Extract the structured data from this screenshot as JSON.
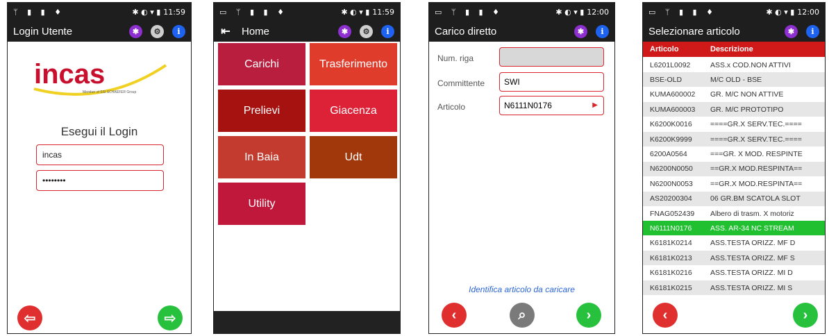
{
  "screens": {
    "login": {
      "status_time": "11:59",
      "title": "Login Utente",
      "logo_text": "incas",
      "logo_subtext": "Member of SSI SCHAEFER Group",
      "heading": "Esegui il Login",
      "username": "incas",
      "password": "••••••••"
    },
    "home": {
      "status_time": "11:59",
      "title": "Home",
      "tiles": [
        "Carichi",
        "Trasferimento",
        "Prelievi",
        "Giacenza",
        "In Baia",
        "Udt",
        "Utility"
      ],
      "tile_colors": [
        "#b91e3f",
        "#e03c2c",
        "#a5120f",
        "#dd2238",
        "#c23b2e",
        "#a0380c",
        "#bf183a"
      ]
    },
    "carico": {
      "status_time": "12:00",
      "title": "Carico diretto",
      "fields": [
        {
          "label": "Num. riga",
          "value": ""
        },
        {
          "label": "Committente",
          "value": "SWI"
        },
        {
          "label": "Articolo",
          "value": "N6111N0176"
        }
      ],
      "hint": "Identifica articolo da caricare"
    },
    "select": {
      "status_time": "12:00",
      "title": "Selezionare articolo",
      "columns": [
        "Articolo",
        "Descrizione"
      ],
      "rows": [
        [
          "L6201L0092",
          "ASS.x COD.NON ATTIVI"
        ],
        [
          "BSE-OLD",
          "M/C OLD - BSE"
        ],
        [
          "KUMA600002",
          "GR. M/C NON ATTIVE"
        ],
        [
          "KUMA600003",
          "GR. M/C PROTOTIPO"
        ],
        [
          "K6200K0016",
          "====GR.X SERV.TEC.===="
        ],
        [
          "K6200K9999",
          "====GR.X SERV.TEC.===="
        ],
        [
          "6200A0564",
          "===GR. X MOD. RESPINTE"
        ],
        [
          "N6200N0050",
          "==GR.X MOD.RESPINTA=="
        ],
        [
          "N6200N0053",
          "==GR.X MOD.RESPINTA=="
        ],
        [
          "AS20200304",
          "06 GR.BM SCATOLA SLOT"
        ],
        [
          "FNAG052439",
          "Albero di trasm. X motoriz"
        ],
        [
          "N6111N0176",
          "ASS. AR-34 NC STREAM"
        ],
        [
          "K6181K0214",
          "ASS.TESTA ORIZZ. MF D"
        ],
        [
          "K6181K0213",
          "ASS.TESTA ORIZZ. MF S"
        ],
        [
          "K6181K0216",
          "ASS.TESTA ORIZZ. MI D"
        ],
        [
          "K6181K0215",
          "ASS.TESTA ORIZZ. MI S"
        ]
      ],
      "selected_index": 11
    }
  }
}
